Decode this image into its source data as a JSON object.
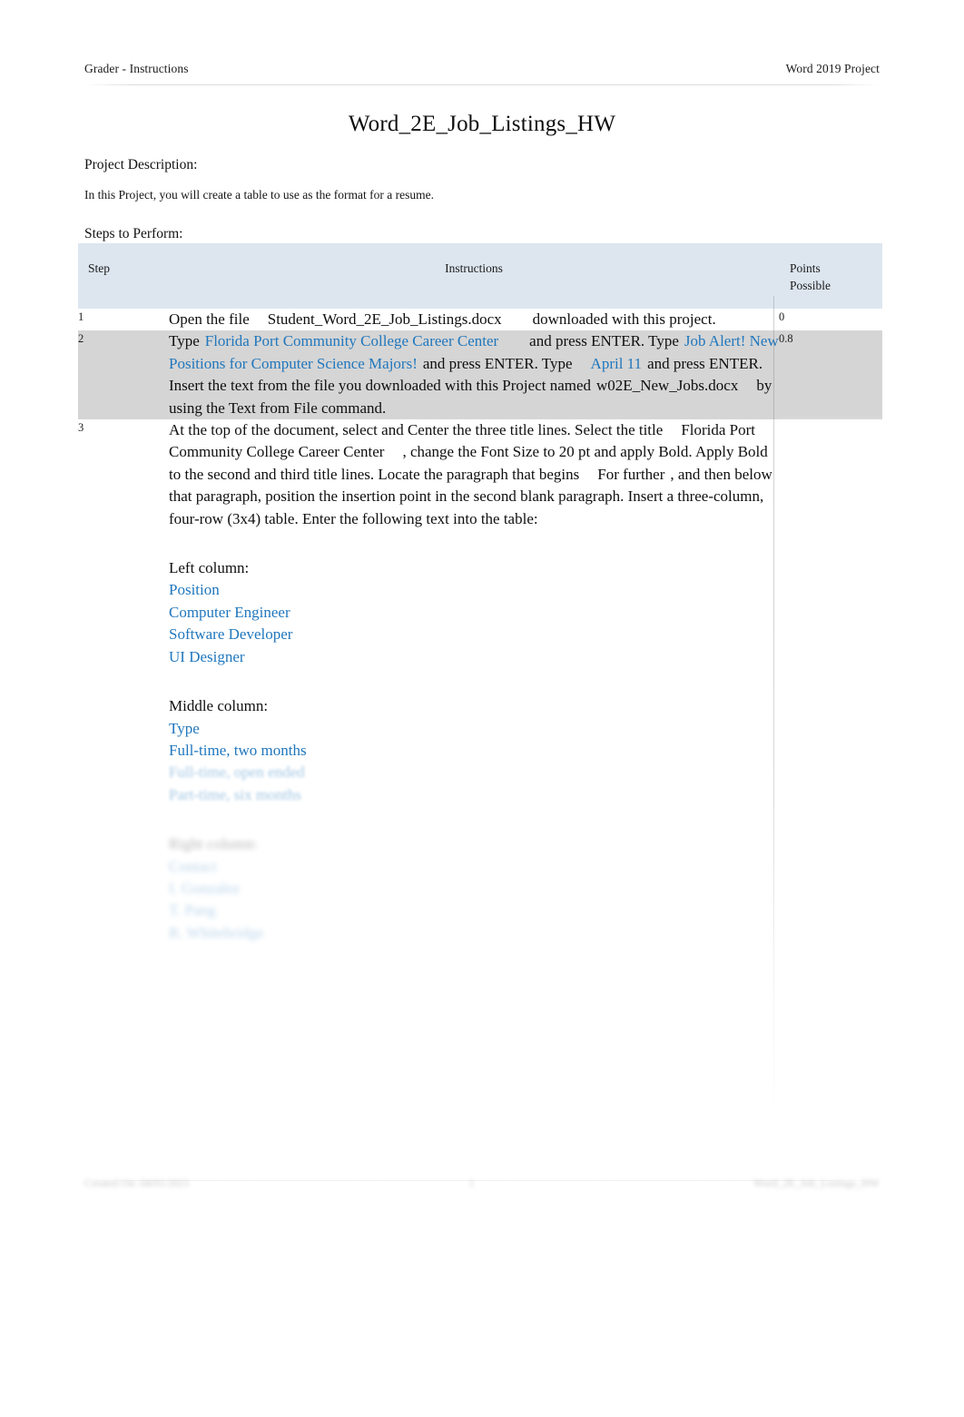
{
  "header": {
    "left": "Grader - Instructions",
    "right": "Word 2019 Project"
  },
  "title": "Word_2E_Job_Listings_HW",
  "intro": {
    "description_label": "Project Description:",
    "description": "In this Project, you will create a table to use as the format for a resume.",
    "steps_label": "Steps to Perform:"
  },
  "table": {
    "headers": {
      "step": "Step",
      "instructions": "Instructions",
      "points": "Points Possible",
      "points_line1": "Points",
      "points_line2": "Possible"
    },
    "rows": [
      {
        "step": "1",
        "points": "0",
        "shaded": false,
        "parts": [
          {
            "text": "Open the file",
            "blue": false
          },
          {
            "text": "Student_Word_2E_Job_Listings.docx",
            "blue": false
          },
          {
            "text": "downloaded with this project.",
            "blue": false
          }
        ]
      },
      {
        "step": "2",
        "points": "0.8",
        "shaded": true,
        "parts": [
          {
            "text": "Type",
            "blue": false
          },
          {
            "text": "Florida Port Community College Career Center",
            "blue": true
          },
          {
            "text": "and press ENTER. Type",
            "blue": false
          },
          {
            "text": "Job Alert! New Positions for Computer Science Majors!",
            "blue": true
          },
          {
            "text": "and press ENTER. Type",
            "blue": false
          },
          {
            "text": "April 11",
            "blue": true
          },
          {
            "text": "and press ENTER. Insert the text from the file you downloaded with this Project named",
            "blue": false
          },
          {
            "text": "w02E_New_Jobs.docx",
            "blue": false
          },
          {
            "text": "by using the Text from File command.",
            "blue": false
          }
        ]
      },
      {
        "step": "3",
        "points": "",
        "shaded": false,
        "paragraph_1": "At the top of the document, select and Center the three title lines. Select the title",
        "title_quote": "Florida Port Community College Career Center",
        "paragraph_2": ", change the Font Size to 20 pt and apply Bold. Apply Bold to the second and third title lines. Locate the paragraph that begins",
        "begins_quote": "For further",
        "paragraph_3": ", and then below that paragraph, position the insertion point in the second blank paragraph. Insert a three-column, four-row (3x4) table. Enter the following text into the table:",
        "columns": [
          {
            "heading": "Left column:",
            "items": [
              "Position",
              "Computer Engineer",
              "Software Developer",
              "UI Designer"
            ]
          },
          {
            "heading": "Middle column:",
            "items": [
              "Type",
              "Full-time, two months",
              "Full-time, open ended",
              "Part-time, six months"
            ]
          },
          {
            "heading": "Right column:",
            "items": [
              "Contact",
              "I. Gonzalez",
              "T. Pang",
              "R. Whitebridge"
            ]
          }
        ]
      }
    ]
  },
  "footer": {
    "left": "Created On: 04/01/2021",
    "center": "1",
    "right": "Word_2E_Job_Listings_HW"
  },
  "colors": {
    "accent_blue": "#2077bd",
    "header_fill": "#dde6ef",
    "shaded_row": "#d5d5d5",
    "text": "#0f0f0f"
  }
}
